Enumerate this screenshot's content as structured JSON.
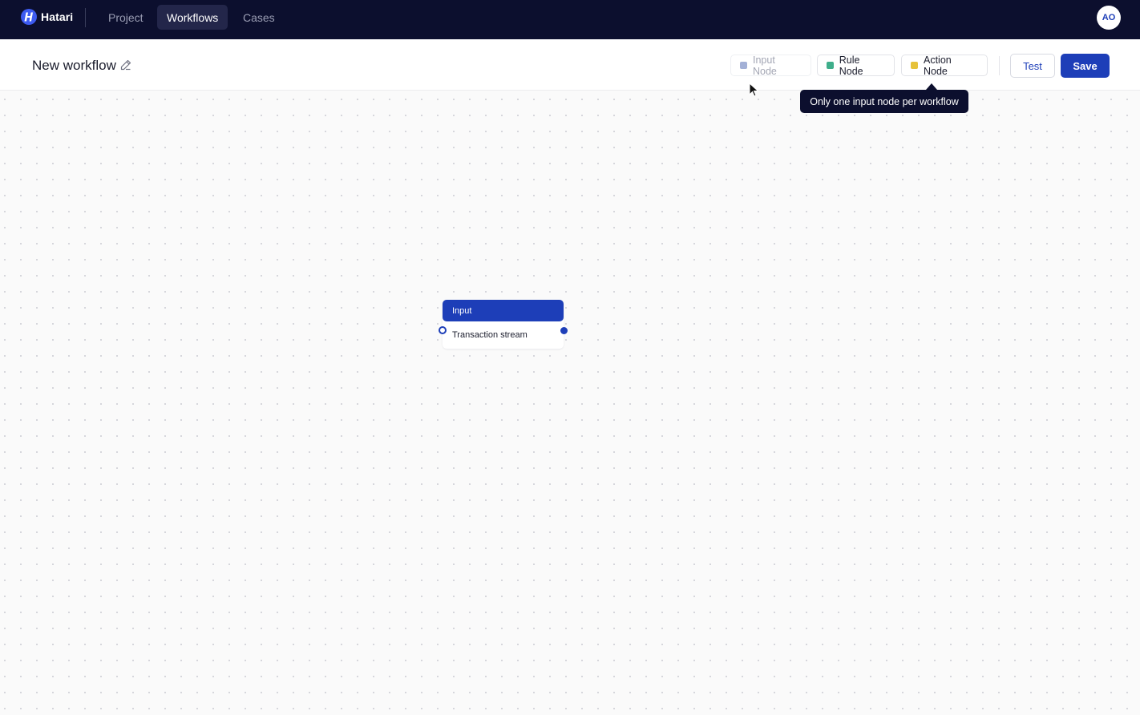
{
  "app": {
    "name": "Hatari",
    "logo_icon": "hatari-logo-icon"
  },
  "nav": {
    "tabs": [
      {
        "label": "Project",
        "active": false
      },
      {
        "label": "Workflows",
        "active": true
      },
      {
        "label": "Cases",
        "active": false
      }
    ]
  },
  "user": {
    "initials": "AO"
  },
  "workflow": {
    "title": "New workflow",
    "edit_icon": "pencil-icon"
  },
  "toolbar": {
    "input_node": {
      "label": "Input Node",
      "color": "#a3b0d6",
      "disabled": true
    },
    "rule_node": {
      "label": "Rule Node",
      "color": "#3fae8b"
    },
    "action_node": {
      "label": "Action Node",
      "color": "#e6c23a"
    },
    "test_label": "Test",
    "save_label": "Save"
  },
  "tooltip": {
    "text": "Only one input node per workflow"
  },
  "canvas": {
    "nodes": [
      {
        "type": "Input",
        "title": "Input",
        "subtitle": "Transaction stream",
        "color": "#1d3eb8"
      }
    ]
  },
  "colors": {
    "topbar": "#0c0f2e",
    "accent": "#1d3eb8",
    "canvas_bg": "#fafafa"
  }
}
